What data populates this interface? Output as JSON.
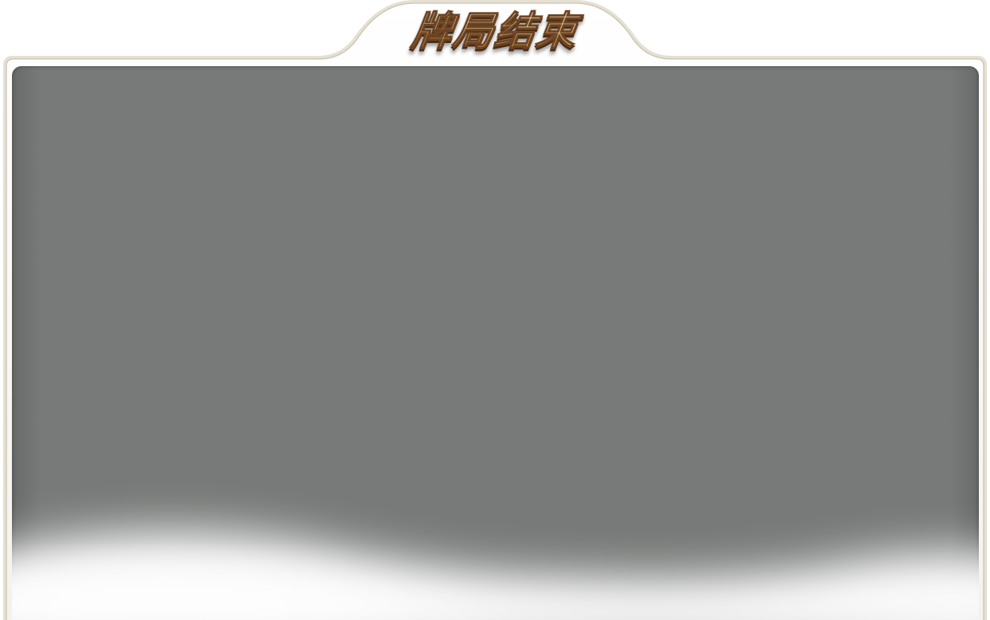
{
  "dialog": {
    "title": "牌局结束"
  },
  "colors": {
    "panel_background": "#777a78",
    "frame_line": "#d8d3c4",
    "title_fill": "#f0d29c",
    "title_outline": "#6b4222"
  }
}
